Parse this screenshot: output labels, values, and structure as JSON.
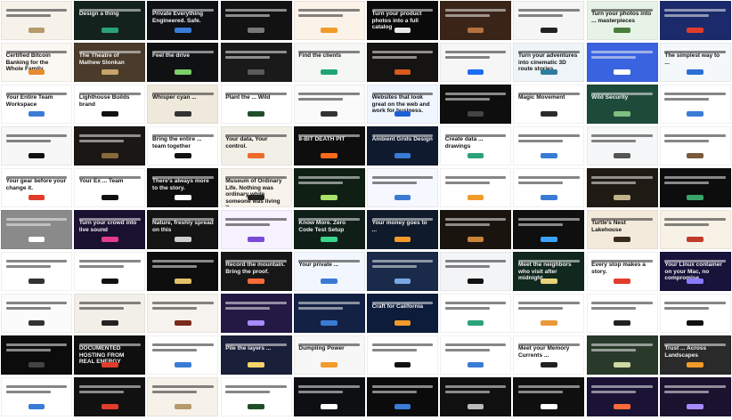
{
  "tiles": [
    {
      "bg": "#f6f2ea",
      "tone": "light",
      "accent": "#b59a6a",
      "text": ""
    },
    {
      "bg": "#13221c",
      "tone": "dark",
      "accent": "#2aa37a",
      "text": "Design a thing"
    },
    {
      "bg": "#0f1114",
      "tone": "dark",
      "accent": "#3a7bd5",
      "text": "Private Everything Engineered. Safe."
    },
    {
      "bg": "#121212",
      "tone": "dark",
      "accent": "#777777",
      "text": ""
    },
    {
      "bg": "#fbf3e9",
      "tone": "light",
      "accent": "#f29b2a",
      "text": ""
    },
    {
      "bg": "#0a0a0a",
      "tone": "dark",
      "accent": "#e8e8e8",
      "text": "Turn your product photos into a full catalog"
    },
    {
      "bg": "#3a2418",
      "tone": "dark",
      "accent": "#b4713c",
      "text": ""
    },
    {
      "bg": "#f5f5f5",
      "tone": "light",
      "accent": "#222222",
      "text": ""
    },
    {
      "bg": "#e8f3e7",
      "tone": "light",
      "accent": "#4a7d3a",
      "text": "Turn your photos into ... masterpieces"
    },
    {
      "bg": "#1b2a6b",
      "tone": "dark",
      "accent": "#e23c2b",
      "text": ""
    },
    {
      "bg": "#fbf7f2",
      "tone": "light",
      "accent": "#e48a2f",
      "text": "Certified Bitcoin Banking for the Whole Family"
    },
    {
      "bg": "#4a3b2b",
      "tone": "dark",
      "accent": "#c9a36a",
      "text": "The Theatre of Mathew Slonkan"
    },
    {
      "bg": "#0f1112",
      "tone": "dark",
      "accent": "#7ccf6b",
      "text": "Feel the drive"
    },
    {
      "bg": "#1a1a1a",
      "tone": "dark",
      "accent": "#5a5a5a",
      "text": ""
    },
    {
      "bg": "#f5f7f5",
      "tone": "light",
      "accent": "#1ea672",
      "text": "Find the clients"
    },
    {
      "bg": "#161412",
      "tone": "dark",
      "accent": "#d85a1e",
      "text": ""
    },
    {
      "bg": "#f6f6f6",
      "tone": "light",
      "accent": "#1c6ef2",
      "text": ""
    },
    {
      "bg": "#eef4f7",
      "tone": "light",
      "accent": "#2c7da0",
      "text": "Turn your adventures into cinematic 3D route stories"
    },
    {
      "bg": "#3a63e0",
      "tone": "dark",
      "accent": "#ffffff",
      "text": ""
    },
    {
      "bg": "#f4f8fb",
      "tone": "light",
      "accent": "#2b6fd6",
      "text": "The simplest way to ..."
    },
    {
      "bg": "#ffffff",
      "tone": "light",
      "accent": "#3a7bd5",
      "text": "Your Entire Team Workspace"
    },
    {
      "bg": "#ffffff",
      "tone": "light",
      "accent": "#111111",
      "text": "Lighthouse Builds brand"
    },
    {
      "bg": "#efe9dc",
      "tone": "light",
      "accent": "#333333",
      "text": "Whisper cyan ..."
    },
    {
      "bg": "#ffffff",
      "tone": "light",
      "accent": "#1f4f2a",
      "text": "Plant the ... Wild"
    },
    {
      "bg": "#fafafa",
      "tone": "light",
      "accent": "#333333",
      "text": ""
    },
    {
      "bg": "#f0f6ff",
      "tone": "light",
      "accent": "#1c5fd6",
      "text": "Websites that look great on the web and work for business."
    },
    {
      "bg": "#0e0e0e",
      "tone": "dark",
      "accent": "#444444",
      "text": ""
    },
    {
      "bg": "#ffffff",
      "tone": "light",
      "accent": "#2c2c2c",
      "text": "Magic Movement"
    },
    {
      "bg": "#1e4a3a",
      "tone": "dark",
      "accent": "#7fbf7f",
      "text": "Wild Security"
    },
    {
      "bg": "#ffffff",
      "tone": "light",
      "accent": "#3a7bd5",
      "text": ""
    },
    {
      "bg": "#f7f7f7",
      "tone": "light",
      "accent": "#111111",
      "text": ""
    },
    {
      "bg": "#1b1714",
      "tone": "dark",
      "accent": "#8a6a3a",
      "text": ""
    },
    {
      "bg": "#ffffff",
      "tone": "light",
      "accent": "#111111",
      "text": "Bring the entire ... team together"
    },
    {
      "bg": "#f2efe6",
      "tone": "light",
      "accent": "#ee6a2a",
      "text": "Your data, Your control."
    },
    {
      "bg": "#0e0e0e",
      "tone": "dark",
      "accent": "#ff6a1a",
      "text": "8-BIT DEATH PIT"
    },
    {
      "bg": "#0f1a2e",
      "tone": "dark",
      "accent": "#3a7bd5",
      "text": "Ambient Grids Design"
    },
    {
      "bg": "#ffffff",
      "tone": "light",
      "accent": "#2aa37a",
      "text": "Create data ... drawings"
    },
    {
      "bg": "#ffffff",
      "tone": "light",
      "accent": "#3a7bd5",
      "text": ""
    },
    {
      "bg": "#f6f7f9",
      "tone": "light",
      "accent": "#555555",
      "text": ""
    },
    {
      "bg": "#ffffff",
      "tone": "light",
      "accent": "#7a5a3a",
      "text": ""
    },
    {
      "bg": "#ffffff",
      "tone": "light",
      "accent": "#e23c2b",
      "text": "Your gear before your change it."
    },
    {
      "bg": "#ffffff",
      "tone": "light",
      "accent": "#111111",
      "text": "Your Ex ... Team"
    },
    {
      "bg": "#0f0f0f",
      "tone": "dark",
      "accent": "#ffffff",
      "text": "There's always more to the story."
    },
    {
      "bg": "#f7f3ea",
      "tone": "light",
      "accent": "#222222",
      "text": "Museum of Ordinary Life. Nothing was ordinary while someone was living it."
    },
    {
      "bg": "#0f1f14",
      "tone": "dark",
      "accent": "#a8e26a",
      "text": ""
    },
    {
      "bg": "#f5f8ff",
      "tone": "light",
      "accent": "#3a7bd5",
      "text": ""
    },
    {
      "bg": "#ffffff",
      "tone": "light",
      "accent": "#f29b2a",
      "text": ""
    },
    {
      "bg": "#ffffff",
      "tone": "light",
      "accent": "#3a7bd5",
      "text": ""
    },
    {
      "bg": "#1f1a14",
      "tone": "dark",
      "accent": "#c2b28a",
      "text": ""
    },
    {
      "bg": "#0d0d0d",
      "tone": "dark",
      "accent": "#3aa36a",
      "text": ""
    },
    {
      "bg": "#8a8a8a",
      "tone": "dark",
      "accent": "#ffffff",
      "text": ""
    },
    {
      "bg": "#1a1030",
      "tone": "dark",
      "accent": "#e23c8a",
      "text": "Turn your crowd into live sound"
    },
    {
      "bg": "#141414",
      "tone": "dark",
      "accent": "#cfcfcf",
      "text": "Nature, freshly spread on this"
    },
    {
      "bg": "#f6f2ff",
      "tone": "light",
      "accent": "#7a4ad6",
      "text": ""
    },
    {
      "bg": "#0f1f18",
      "tone": "dark",
      "accent": "#3ad68a",
      "text": "Know More. Zero Code Test Setup"
    },
    {
      "bg": "#0f1a2a",
      "tone": "dark",
      "accent": "#f29b2a",
      "text": "Your money goes to ..."
    },
    {
      "bg": "#1a140e",
      "tone": "dark",
      "accent": "#c9843a",
      "text": ""
    },
    {
      "bg": "#0f0f0f",
      "tone": "dark",
      "accent": "#3aa3ff",
      "text": ""
    },
    {
      "bg": "#f4eadb",
      "tone": "light",
      "accent": "#3a2a1a",
      "text": "Turtle's Nest Lakehouse"
    },
    {
      "bg": "#f7f1e6",
      "tone": "light",
      "accent": "#c23a2a",
      "text": ""
    },
    {
      "bg": "#ffffff",
      "tone": "light",
      "accent": "#333333",
      "text": ""
    },
    {
      "bg": "#ffffff",
      "tone": "light",
      "accent": "#111111",
      "text": ""
    },
    {
      "bg": "#0e0e0e",
      "tone": "dark",
      "accent": "#e2c16a",
      "text": ""
    },
    {
      "bg": "#171717",
      "tone": "dark",
      "accent": "#ff6a3a",
      "text": "Record the mountain. Bring the proof."
    },
    {
      "bg": "#f2f7ff",
      "tone": "light",
      "accent": "#3a7bd5",
      "text": "Your private ..."
    },
    {
      "bg": "#1a2a4a",
      "tone": "dark",
      "accent": "#7aa7e2",
      "text": ""
    },
    {
      "bg": "#f3f4f6",
      "tone": "light",
      "accent": "#111111",
      "text": ""
    },
    {
      "bg": "#11281e",
      "tone": "dark",
      "accent": "#e8d27a",
      "text": "Meet the neighbors who visit after midnight."
    },
    {
      "bg": "#ffffff",
      "tone": "light",
      "accent": "#e23c2b",
      "text": "Every stop makes a story."
    },
    {
      "bg": "#17133a",
      "tone": "dark",
      "accent": "#8a7aff",
      "text": "Your Linux container on your Mac, no compromise."
    },
    {
      "bg": "#fbfbfb",
      "tone": "light",
      "accent": "#333333",
      "text": ""
    },
    {
      "bg": "#f2efe8",
      "tone": "light",
      "accent": "#222222",
      "text": ""
    },
    {
      "bg": "#f6f3ee",
      "tone": "light",
      "accent": "#7a2a1a",
      "text": ""
    },
    {
      "bg": "#241845",
      "tone": "dark",
      "accent": "#a88aff",
      "text": ""
    },
    {
      "bg": "#132144",
      "tone": "dark",
      "accent": "#3a7bd5",
      "text": ""
    },
    {
      "bg": "#0c1c3a",
      "tone": "dark",
      "accent": "#f29b2a",
      "text": "Craft for California"
    },
    {
      "bg": "#ffffff",
      "tone": "light",
      "accent": "#2aa37a",
      "text": ""
    },
    {
      "bg": "#ffffff",
      "tone": "light",
      "accent": "#e89a3a",
      "text": ""
    },
    {
      "bg": "#ffffff",
      "tone": "light",
      "accent": "#222222",
      "text": ""
    },
    {
      "bg": "#ffffff",
      "tone": "light",
      "accent": "#111111",
      "text": ""
    },
    {
      "bg": "#0c0c0c",
      "tone": "dark",
      "accent": "#444444",
      "text": ""
    },
    {
      "bg": "#0f0f0f",
      "tone": "dark",
      "accent": "#e23c2b",
      "text": "DOCUMENTED HOSTING FROM REAL ENERGY"
    },
    {
      "bg": "#ffffff",
      "tone": "light",
      "accent": "#3a7bd5",
      "text": ""
    },
    {
      "bg": "#1a1f3a",
      "tone": "dark",
      "accent": "#f5d46a",
      "text": "Pile the layers ..."
    },
    {
      "bg": "#f7f7f7",
      "tone": "light",
      "accent": "#f29b2a",
      "text": "Dumpling Power"
    },
    {
      "bg": "#ffffff",
      "tone": "light",
      "accent": "#111111",
      "text": ""
    },
    {
      "bg": "#ffffff",
      "tone": "light",
      "accent": "#3a7bd5",
      "text": ""
    },
    {
      "bg": "#ffffff",
      "tone": "light",
      "accent": "#222222",
      "text": "Meet your Memory Currents ..."
    },
    {
      "bg": "#2a3a2a",
      "tone": "dark",
      "accent": "#cfd8a0",
      "text": ""
    },
    {
      "bg": "#2a2a2a",
      "tone": "dark",
      "accent": "#f29b2a",
      "text": "Trust ... Across Landscapes"
    },
    {
      "bg": "#ffffff",
      "tone": "light",
      "accent": "#3a7bd5",
      "text": ""
    },
    {
      "bg": "#111111",
      "tone": "dark",
      "accent": "#e23c2b",
      "text": ""
    },
    {
      "bg": "#f7f2e9",
      "tone": "light",
      "accent": "#b59a6a",
      "text": ""
    },
    {
      "bg": "#ffffff",
      "tone": "light",
      "accent": "#1f4f2a",
      "text": ""
    },
    {
      "bg": "#0d0f12",
      "tone": "dark",
      "accent": "#ffffff",
      "text": ""
    },
    {
      "bg": "#0b0b0b",
      "tone": "dark",
      "accent": "#3a7bd5",
      "text": ""
    },
    {
      "bg": "#101010",
      "tone": "dark",
      "accent": "#bbbbbb",
      "text": ""
    },
    {
      "bg": "#0f0f0f",
      "tone": "dark",
      "accent": "#ffffff",
      "text": ""
    },
    {
      "bg": "#1a1335",
      "tone": "dark",
      "accent": "#ff6a3a",
      "text": ""
    },
    {
      "bg": "#1b1230",
      "tone": "dark",
      "accent": "#a88aff",
      "text": ""
    }
  ]
}
